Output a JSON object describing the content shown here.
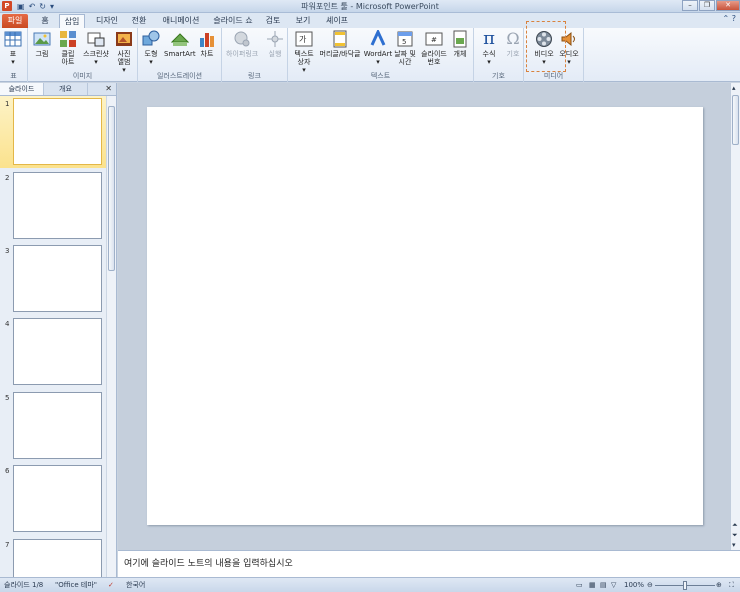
{
  "window": {
    "title": "파워포인트 툴 - Microsoft PowerPoint",
    "app_icon": "P",
    "qat": [
      "save-icon",
      "undo-icon",
      "redo-icon",
      "customize-icon"
    ],
    "controls": [
      "–",
      "❐",
      "✕"
    ]
  },
  "tabs": [
    {
      "label": "파일"
    },
    {
      "label": "홈"
    },
    {
      "label": "삽입"
    },
    {
      "label": "디자인"
    },
    {
      "label": "전환"
    },
    {
      "label": "애니메이션"
    },
    {
      "label": "슬라이드 쇼"
    },
    {
      "label": "검토"
    },
    {
      "label": "보기"
    },
    {
      "label": "셰이프"
    }
  ],
  "active_tab": "삽입",
  "ribbon": {
    "groups": [
      {
        "label": "표",
        "commands": [
          "표"
        ]
      },
      {
        "label": "이미지",
        "commands": [
          "그림",
          "클립 아트",
          "스크린샷",
          "사진 앨범"
        ]
      },
      {
        "label": "일러스트레이션",
        "commands": [
          "도형",
          "SmartArt",
          "차트"
        ]
      },
      {
        "label": "링크",
        "commands": [
          "하이퍼링크",
          "실행"
        ]
      },
      {
        "label": "텍스트",
        "commands": [
          "텍스트 상자",
          "머리글/바닥글",
          "WordArt",
          "날짜 및 시간",
          "슬라이드 번호",
          "개체"
        ]
      },
      {
        "label": "기호",
        "commands": [
          "수식",
          "기호"
        ]
      },
      {
        "label": "미디어",
        "commands": [
          "비디오",
          "오디오"
        ]
      }
    ]
  },
  "left_pane": {
    "tabs": [
      "슬라이드",
      "개요"
    ],
    "close": "✕",
    "slide_numbers": [
      "1",
      "2",
      "3",
      "4",
      "5",
      "6",
      "7"
    ],
    "selected": "1"
  },
  "notes": {
    "placeholder": "여기에 슬라이드 노트의 내용을 입력하십시오"
  },
  "status": {
    "slide": "슬라이드 1/8",
    "theme": "\"Office 테마\"",
    "language": "한국어",
    "zoom": "100%",
    "zoom_level": 0.5
  },
  "colors": {
    "file_tab": "#d24726",
    "highlight": "#d9823d"
  }
}
